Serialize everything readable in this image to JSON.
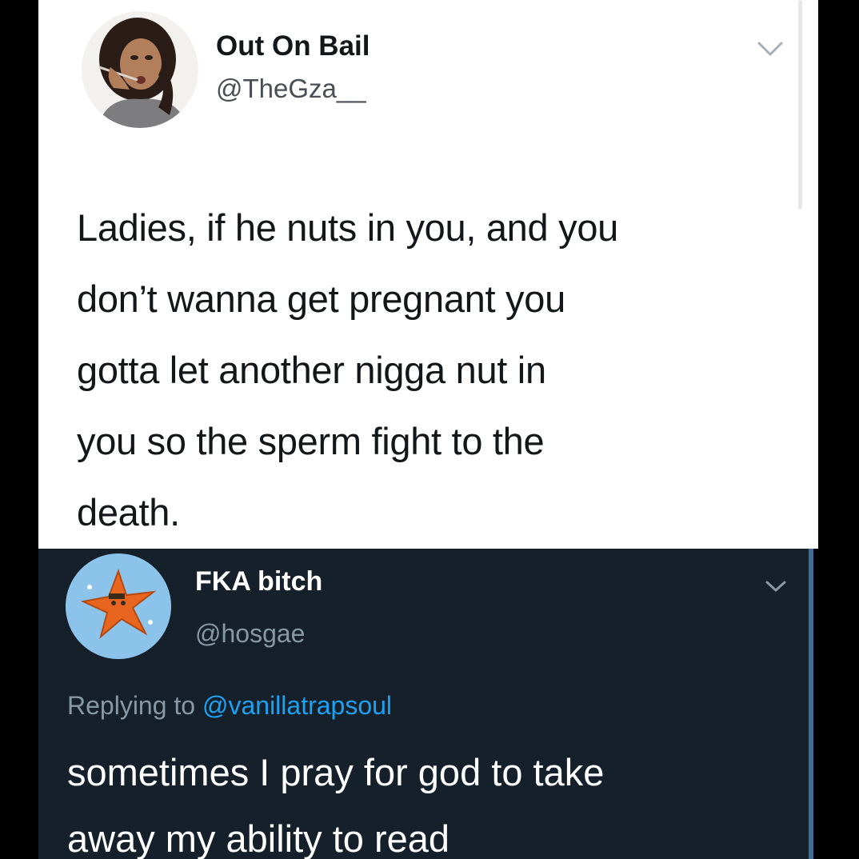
{
  "original_tweet": {
    "display_name": "Out On Bail",
    "handle": "@TheGza__",
    "text": "Ladies, if he nuts in you, and you\ndon’t wanna get pregnant you\ngotta let another nigga nut in\nyou so the sperm fight to the\ndeath.",
    "menu_icon": "chevron-down-icon",
    "theme": "light"
  },
  "reply_tweet": {
    "display_name": "FKA bitch",
    "handle": "@hosgae",
    "replying_prefix": "Replying to",
    "replying_to": "@vanillatrapsoul",
    "text": "sometimes I pray for god to take\naway my ability to read",
    "menu_icon": "chevron-down-icon",
    "theme": "dark"
  },
  "colors": {
    "light_background": "#ffffff",
    "dark_background": "#15202b",
    "mention_blue": "#1da1f2",
    "dark_secondary_text": "#8899a6",
    "light_secondary_text": "#4a4f55",
    "frame": "#000000"
  }
}
